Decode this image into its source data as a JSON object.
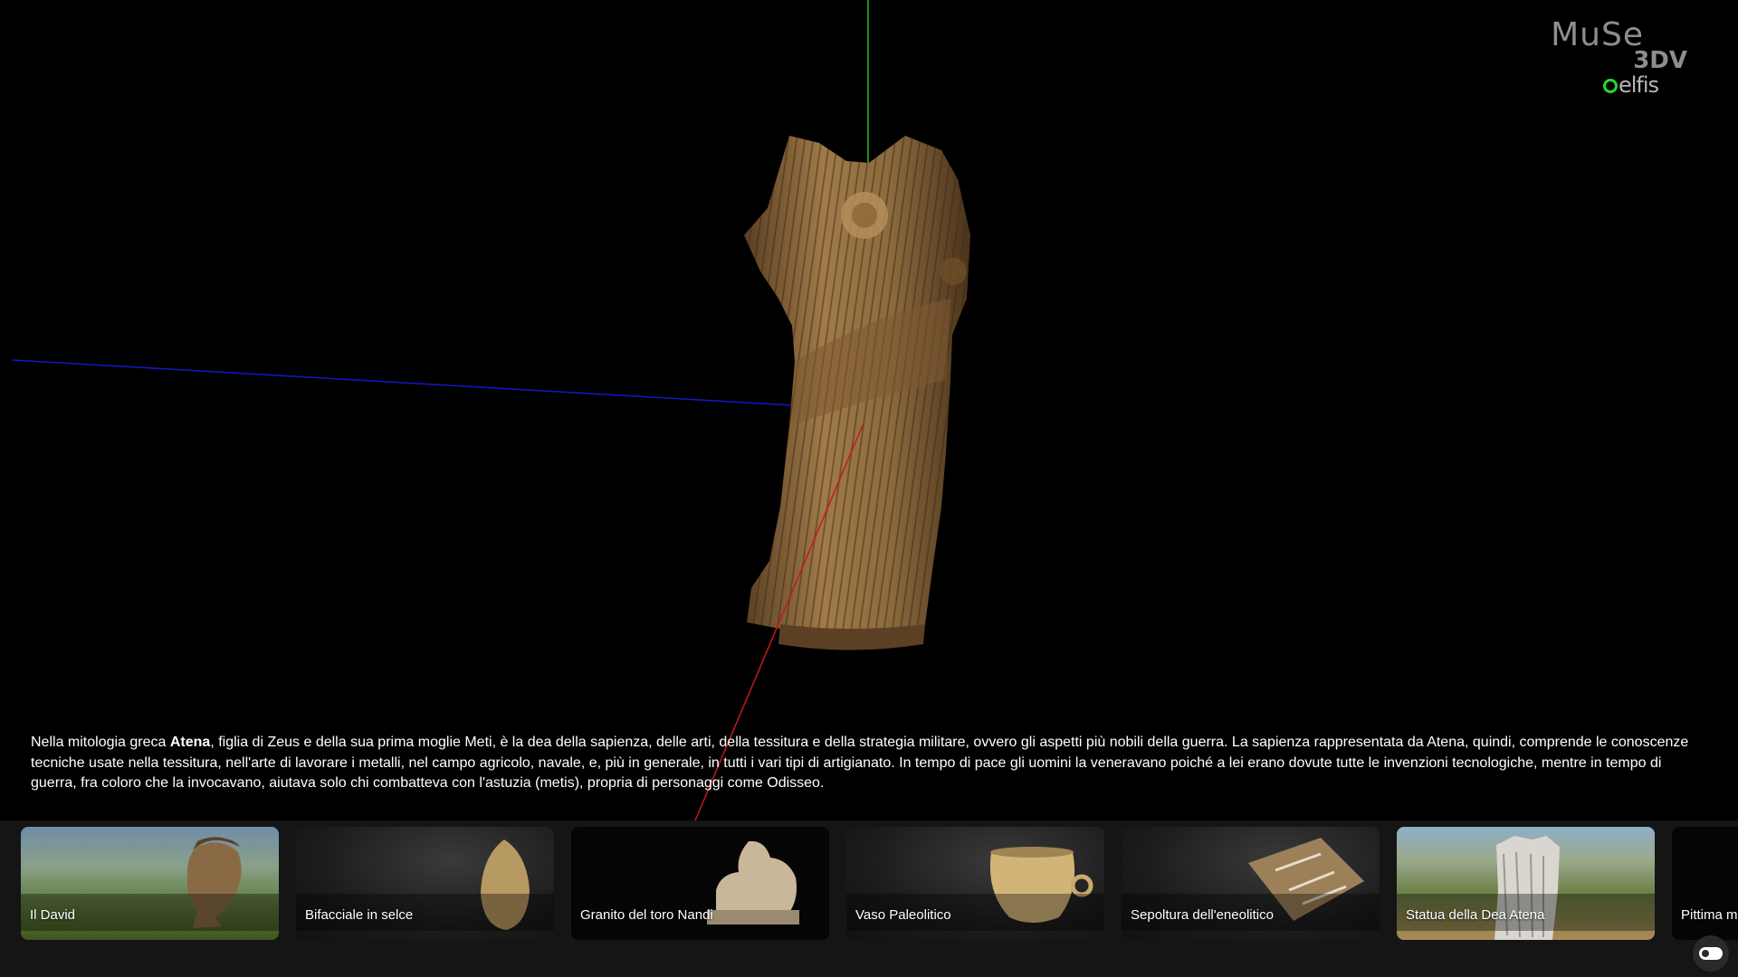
{
  "logo": {
    "muse": "MuSe",
    "suffix": "3DV",
    "partner": "elfis"
  },
  "description": {
    "intro": "Nella mitologia greca ",
    "highlight": "Atena",
    "rest": ", figlia di Zeus e della sua prima moglie Meti, è la dea della sapienza, delle arti, della tessitura e della strategia militare, ovvero gli aspetti più nobili della guerra. La sapienza rappresentata da Atena, quindi, comprende le conoscenze tecniche usate nella tessitura, nell'arte di lavorare i metalli, nel campo agricolo, navale, e, più in generale, in tutti i vari tipi di artigianato. In tempo di pace gli uomini la veneravano poiché a lei erano dovute tutte le invenzioni tecnologiche, mentre in tempo di guerra, fra coloro che la invocavano, aiutava solo chi combatteva con l'astuzia (metis), propria di personaggi come Odisseo."
  },
  "gallery": {
    "items": [
      {
        "label": "Il David"
      },
      {
        "label": "Bifacciale in selce"
      },
      {
        "label": "Granito del toro Nandi"
      },
      {
        "label": "Vaso Paleolitico"
      },
      {
        "label": "Sepoltura dell'eneolitico"
      },
      {
        "label": "Statua della Dea Atena"
      },
      {
        "label": "Pittima mi"
      }
    ]
  },
  "viewer": {
    "axis_colors": {
      "x": "#c41a1a",
      "y": "#1fbf1f",
      "z": "#1616c4"
    },
    "statue_color": "#9c7544"
  }
}
